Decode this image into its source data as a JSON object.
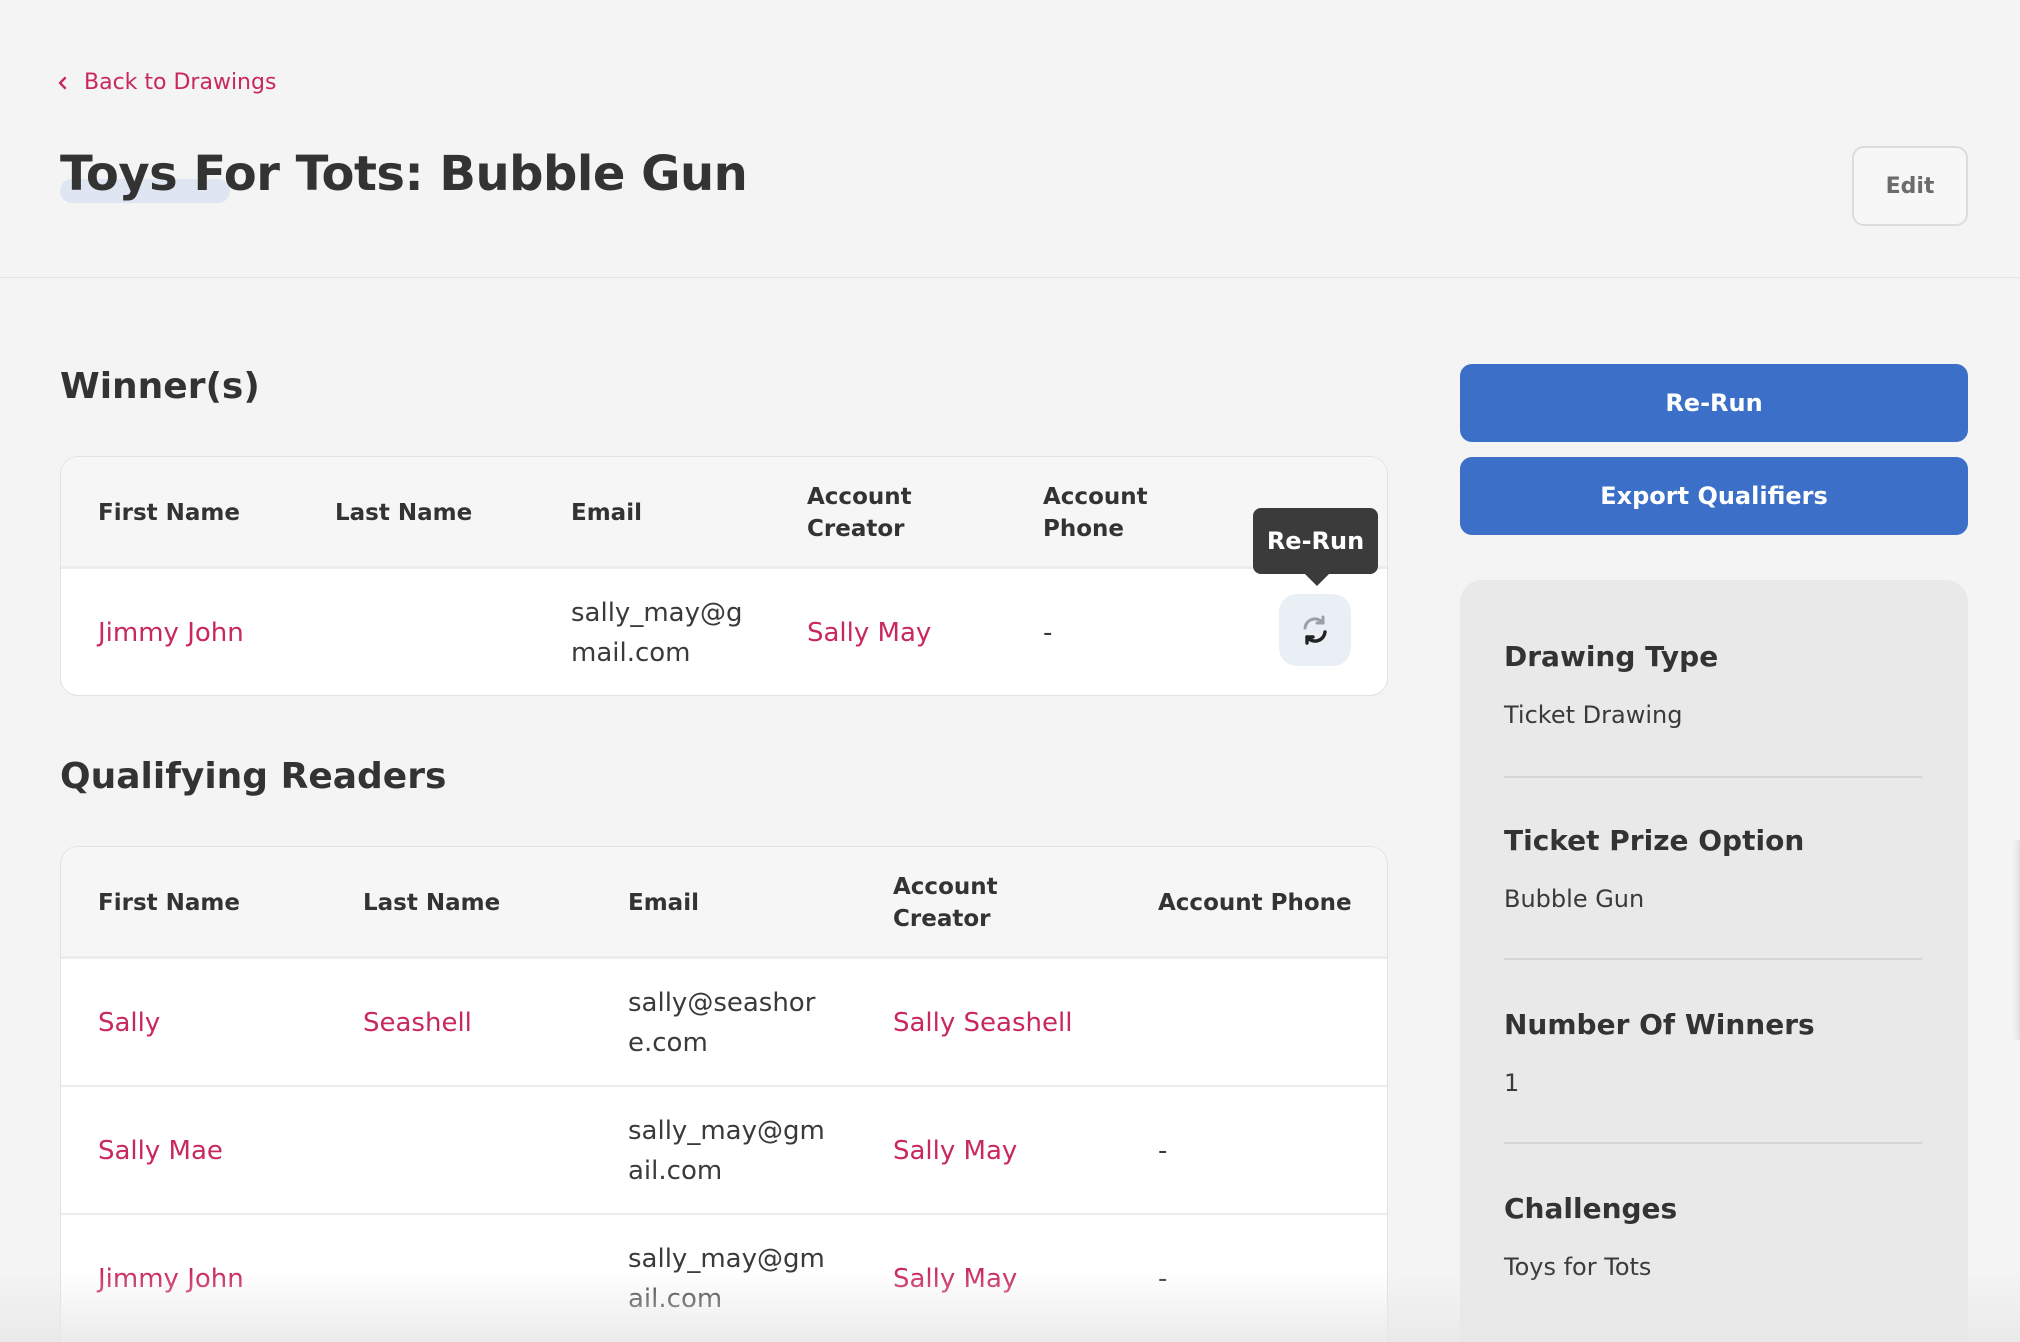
{
  "header": {
    "back_label": "Back to Drawings",
    "title": "Toys For Tots: Bubble Gun",
    "edit_label": "Edit"
  },
  "winners": {
    "section_title": "Winner(s)",
    "columns": [
      "First Name",
      "Last Name",
      "Email",
      "Account Creator",
      "Account Phone"
    ],
    "rows": [
      {
        "first_name": "Jimmy John",
        "last_name": "",
        "email": "sally_may@gmail.com",
        "account_creator": "Sally May",
        "account_phone": "-"
      }
    ],
    "rerun_tooltip": "Re-Run"
  },
  "qualifiers": {
    "section_title": "Qualifying Readers",
    "columns": [
      "First Name",
      "Last Name",
      "Email",
      "Account Creator",
      "Account Phone"
    ],
    "rows": [
      {
        "first_name": "Sally",
        "last_name": "Seashell",
        "email": "sally@seashore.com",
        "account_creator": "Sally Seashell",
        "account_phone": ""
      },
      {
        "first_name": "Sally Mae",
        "last_name": "",
        "email": "sally_may@gmail.com",
        "account_creator": "Sally May",
        "account_phone": "-"
      },
      {
        "first_name": "Jimmy John",
        "last_name": "",
        "email": "sally_may@gmail.com",
        "account_creator": "Sally May",
        "account_phone": "-"
      }
    ]
  },
  "actions": {
    "rerun_label": "Re-Run",
    "export_label": "Export Qualifiers"
  },
  "details": [
    {
      "label": "Drawing Type",
      "value": "Ticket Drawing"
    },
    {
      "label": "Ticket Prize Option",
      "value": "Bubble Gun"
    },
    {
      "label": "Number Of Winners",
      "value": "1"
    },
    {
      "label": "Challenges",
      "value": "Toys for Tots"
    }
  ],
  "colors": {
    "accent_link": "#c8285e",
    "primary_button": "#3c6fc8",
    "page_background": "#f4f4f4"
  }
}
